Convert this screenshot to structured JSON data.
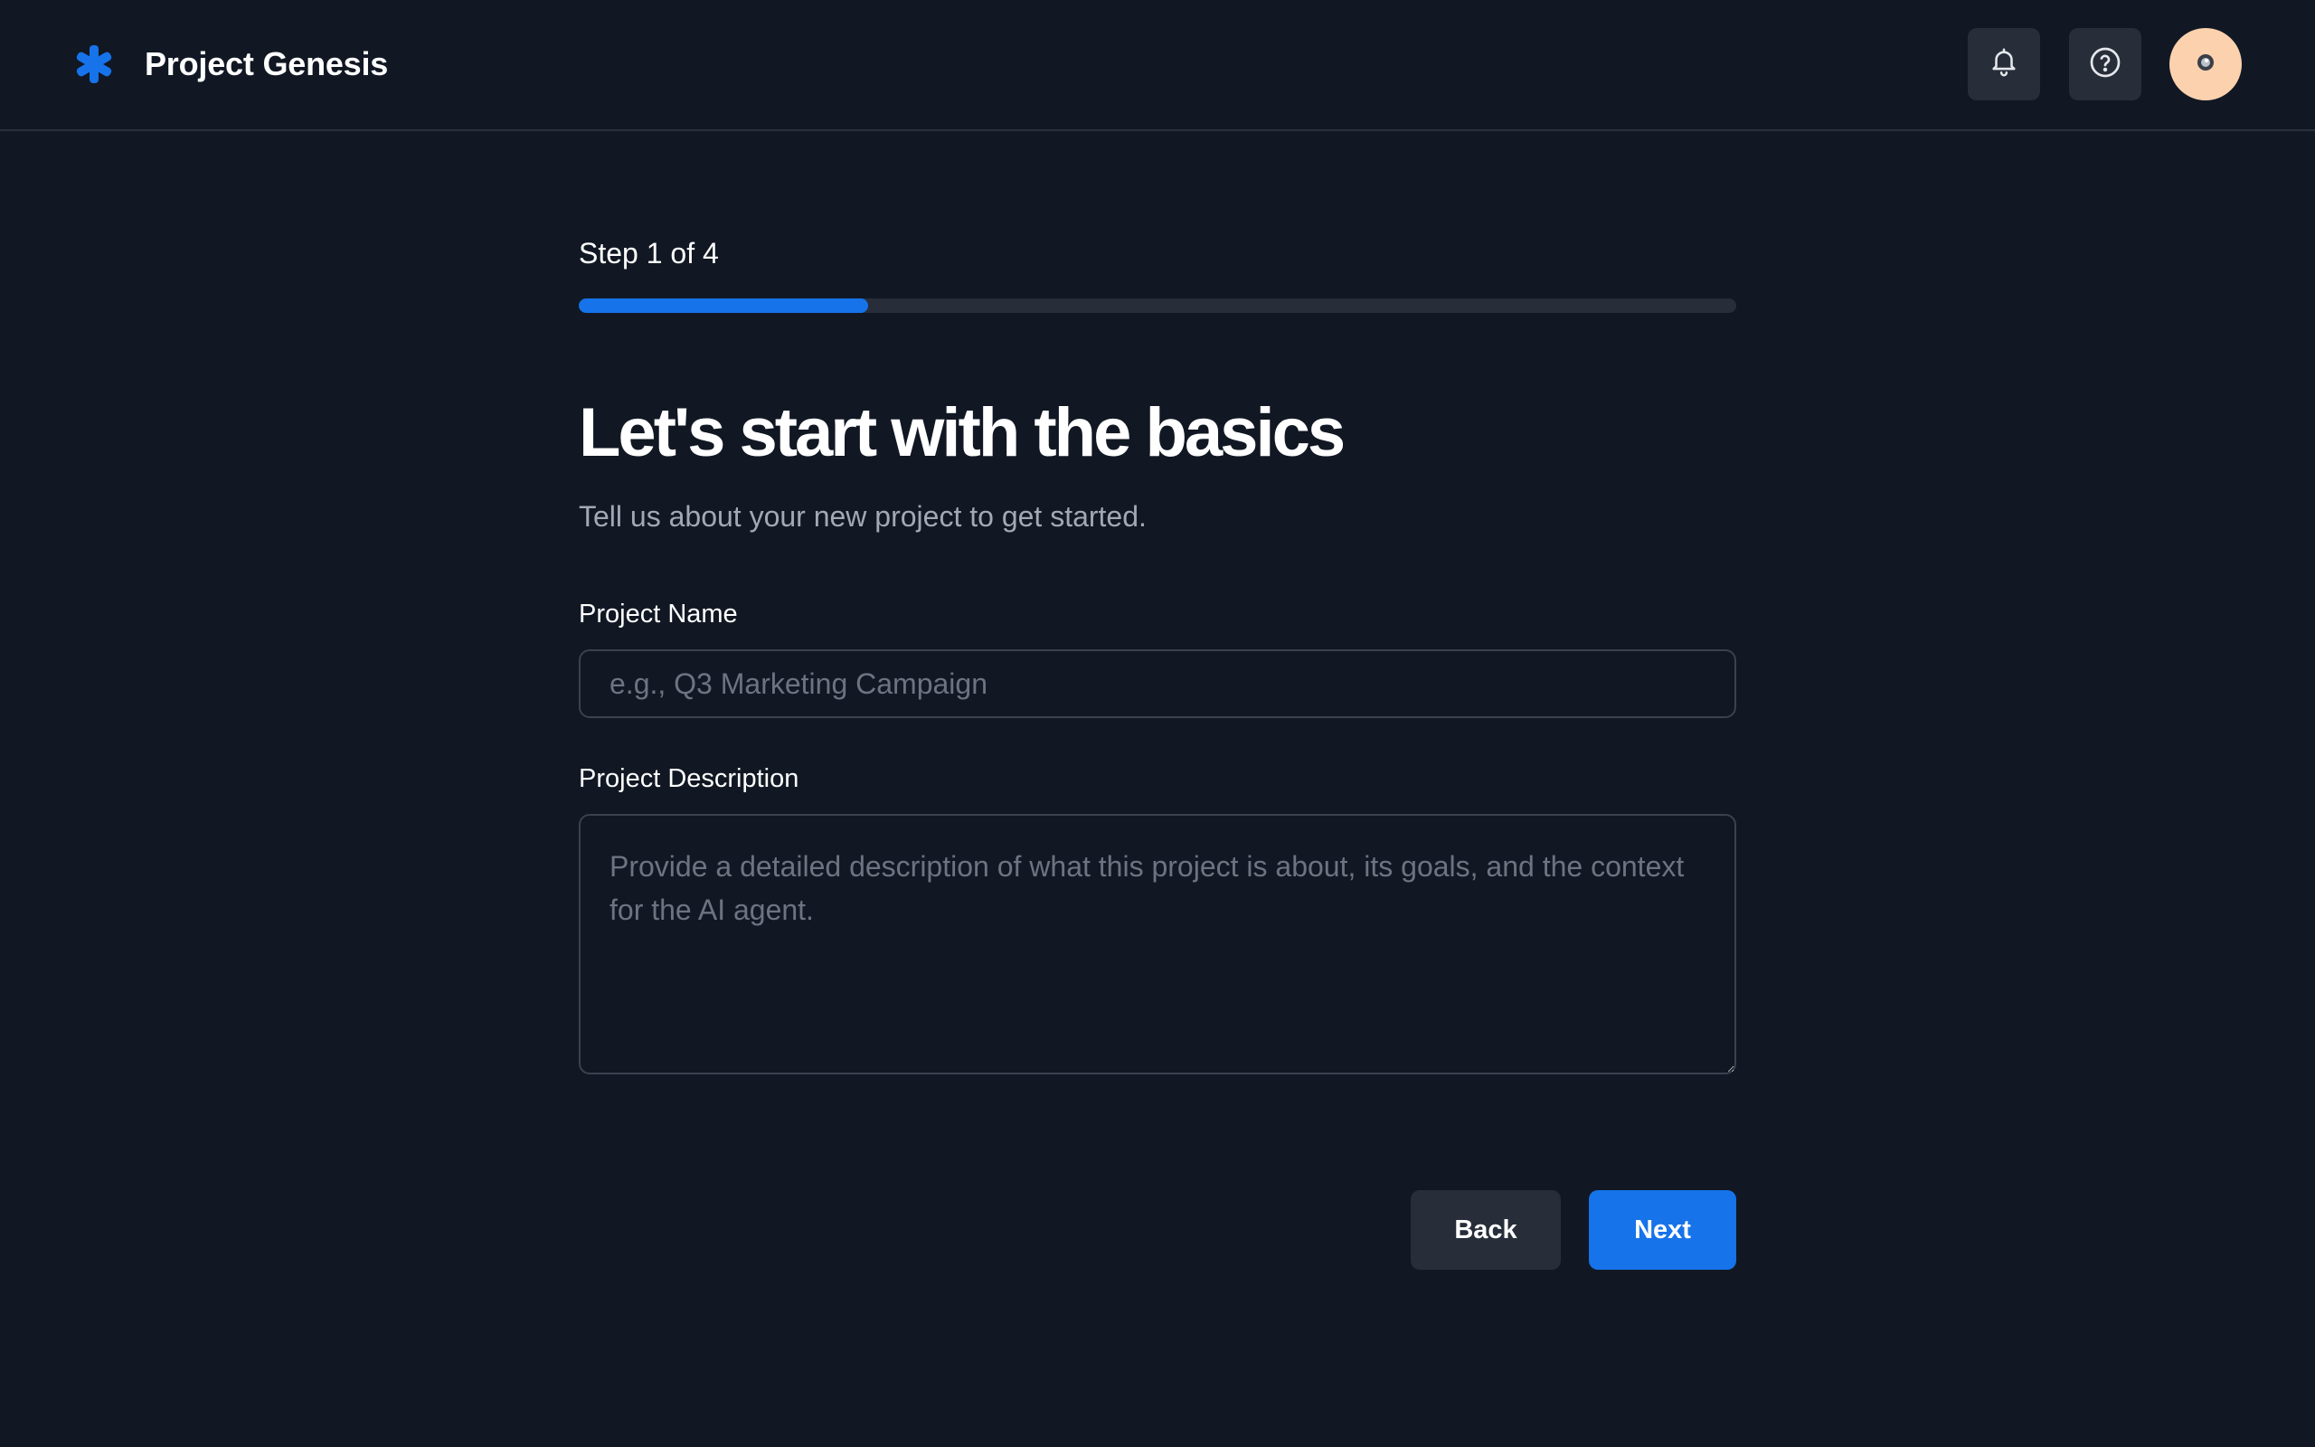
{
  "app": {
    "name": "Project Genesis"
  },
  "header": {
    "icons": [
      "asterisk-logo-icon",
      "bell-icon",
      "help-circle-icon",
      "avatar"
    ]
  },
  "wizard": {
    "step_label": "Step 1 of 4",
    "current_step": 1,
    "total_steps": 4,
    "progress_fraction": 0.25,
    "title": "Let's start with the basics",
    "subtitle": "Tell us about your new project to get started.",
    "fields": {
      "name": {
        "label": "Project Name",
        "value": "",
        "placeholder": "e.g., Q3 Marketing Campaign"
      },
      "description": {
        "label": "Project Description",
        "value": "",
        "placeholder": "Provide a detailed description of what this project is about, its goals, and the context for the AI agent."
      }
    },
    "buttons": {
      "back": "Back",
      "next": "Next"
    }
  },
  "colors": {
    "background": "#111823",
    "accent": "#1673ea",
    "surface": "#272e39",
    "muted_text": "#a2a9b5",
    "avatar": "#fcd1ae"
  }
}
